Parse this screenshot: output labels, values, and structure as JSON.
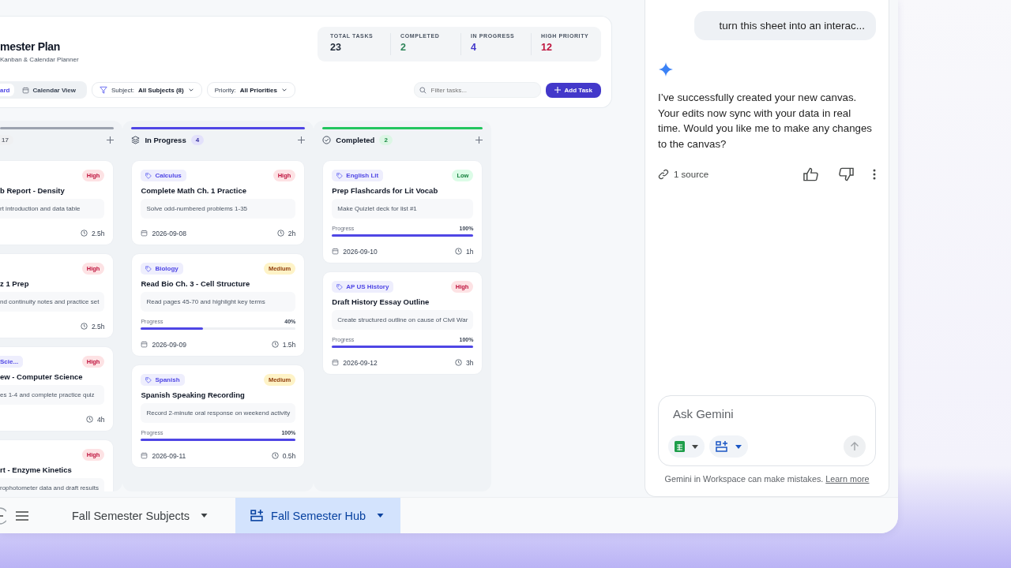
{
  "header": {
    "title": "mester Plan",
    "subtitle": "Kanban & Calendar Planner"
  },
  "stats": [
    {
      "label": "TOTAL TASKS",
      "value": "23",
      "color": "#1f2937"
    },
    {
      "label": "COMPLETED",
      "value": "2",
      "color": "#2f855a"
    },
    {
      "label": "IN PROGRESS",
      "value": "4",
      "color": "#4338ca"
    },
    {
      "label": "HIGH PRIORITY",
      "value": "12",
      "color": "#be123c"
    }
  ],
  "views": [
    {
      "label": "ard",
      "selected": true
    },
    {
      "label": "Calendar View",
      "selected": false
    }
  ],
  "filters": [
    {
      "label": "Subject:",
      "value": "All Subjects (8)"
    },
    {
      "label": "Priority:",
      "value": "All Priorities"
    }
  ],
  "search": {
    "placeholder": "Filter tasks..."
  },
  "add_button": "Add Task",
  "columns": [
    {
      "kind": "todo",
      "count": "17",
      "color": "#9ca3af",
      "cards": [
        {
          "priority": {
            "label": "High",
            "kind": "high"
          },
          "title": "b Report - Density",
          "description": "rt introduction and data table",
          "duration": "2.5h"
        },
        {
          "priority": {
            "label": "High",
            "kind": "high"
          },
          "title": "z 1 Prep",
          "description": "nd continuity notes and practice set",
          "duration": "2.5h"
        },
        {
          "tag": "Scie...",
          "priority": {
            "label": "High",
            "kind": "high"
          },
          "title": "ew - Computer Science",
          "description": "es 1-4 and complete practice quiz",
          "duration": "4h"
        },
        {
          "priority": {
            "label": "High",
            "kind": "high"
          },
          "title": "rt - Enzyme Kinetics",
          "description": "rophotometer data and draft results"
        }
      ]
    },
    {
      "kind": "progress",
      "title": "In Progress",
      "count": "4",
      "color": "#4f46e5",
      "cards": [
        {
          "tag": "Calculus",
          "priority": {
            "label": "High",
            "kind": "high"
          },
          "title": "Complete Math Ch. 1 Practice",
          "description": "Solve odd-numbered problems 1-35",
          "date": "2026-09-08",
          "duration": "2h"
        },
        {
          "tag": "Biology",
          "priority": {
            "label": "Medium",
            "kind": "medium"
          },
          "title": "Read Bio Ch. 3 - Cell Structure",
          "description": "Read pages 45-70 and highlight key terms",
          "progress": {
            "label": "Progress",
            "reading": "40%",
            "level": 0.4
          },
          "date": "2026-09-09",
          "duration": "1.5h"
        },
        {
          "tag": "Spanish",
          "priority": {
            "label": "Medium",
            "kind": "medium"
          },
          "title": "Spanish Speaking Recording",
          "description": "Record 2-minute oral response on weekend activity",
          "progress": {
            "label": "Progress",
            "reading": "100%",
            "level": 1
          },
          "date": "2026-09-11",
          "duration": "0.5h"
        }
      ]
    },
    {
      "kind": "done",
      "title": "Completed",
      "count": "2",
      "color": "#22c55e",
      "cards": [
        {
          "tag": "English Lit",
          "priority": {
            "label": "Low",
            "kind": "low"
          },
          "title": "Prep Flashcards for Lit Vocab",
          "description": "Make Quizlet deck for list #1",
          "progress": {
            "label": "Progress",
            "reading": "100%",
            "level": 1
          },
          "date": "2026-09-10",
          "duration": "1h"
        },
        {
          "tag": "AP US History",
          "priority": {
            "label": "High",
            "kind": "high"
          },
          "title": "Draft History Essay Outline",
          "description": "Create structured outline on cause of Civil War",
          "progress": {
            "label": "Progress",
            "reading": "100%",
            "level": 1
          },
          "date": "2026-09-12",
          "duration": "3h"
        }
      ]
    }
  ],
  "gemini": {
    "user_message": "turn this sheet into an interac...",
    "reply": "I’ve successfully created your new canvas. Your edits now sync with your data in real time. Would you like me to make any changes to the canvas?",
    "sources": "1 source",
    "input": {
      "placeholder": "Ask Gemini"
    },
    "send_disabled": true,
    "disclaimer": "Gemini in Workspace can make mistakes.",
    "learn_more": "Learn more"
  },
  "sheet_tabs": [
    {
      "label": "Fall Semester Subjects",
      "selected": false,
      "kind": "sheet"
    },
    {
      "label": "Fall Semester Hub",
      "selected": true,
      "kind": "canvas"
    }
  ]
}
